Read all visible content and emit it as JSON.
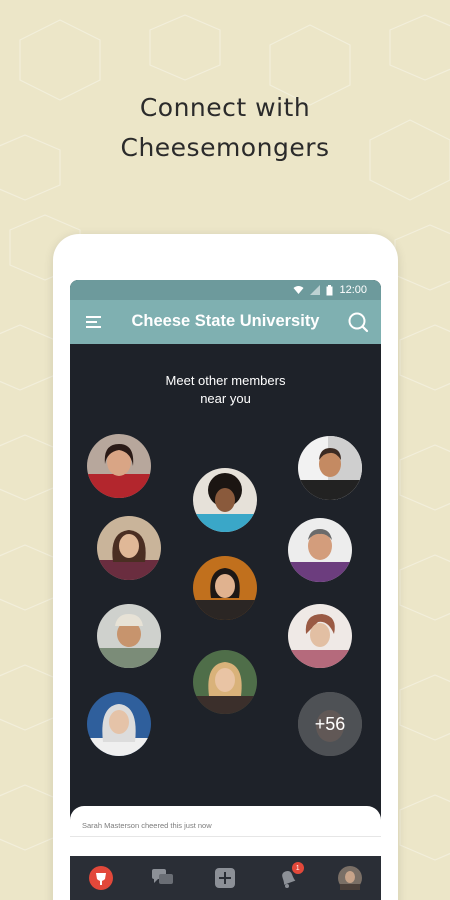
{
  "headline": {
    "line1": "Connect with",
    "line2": "Cheesemongers"
  },
  "status_bar": {
    "time": "12:00"
  },
  "app_bar": {
    "title": "Cheese State University"
  },
  "nearby": {
    "intro_line1": "Meet other members",
    "intro_line2": "near you",
    "more_count": "+56"
  },
  "activity": {
    "text": "Sarah Masterson cheered this just now"
  },
  "bottom_nav": {
    "items": [
      "cheer-icon",
      "chat-icon",
      "add-icon",
      "bell-icon",
      "profile-avatar"
    ],
    "notification_badge": "1"
  },
  "colors": {
    "background": "#ece6c8",
    "status_bar": "#6d9a9c",
    "app_bar": "#7fb0b1",
    "screen": "#1e2229",
    "accent_red": "#e2483a"
  }
}
